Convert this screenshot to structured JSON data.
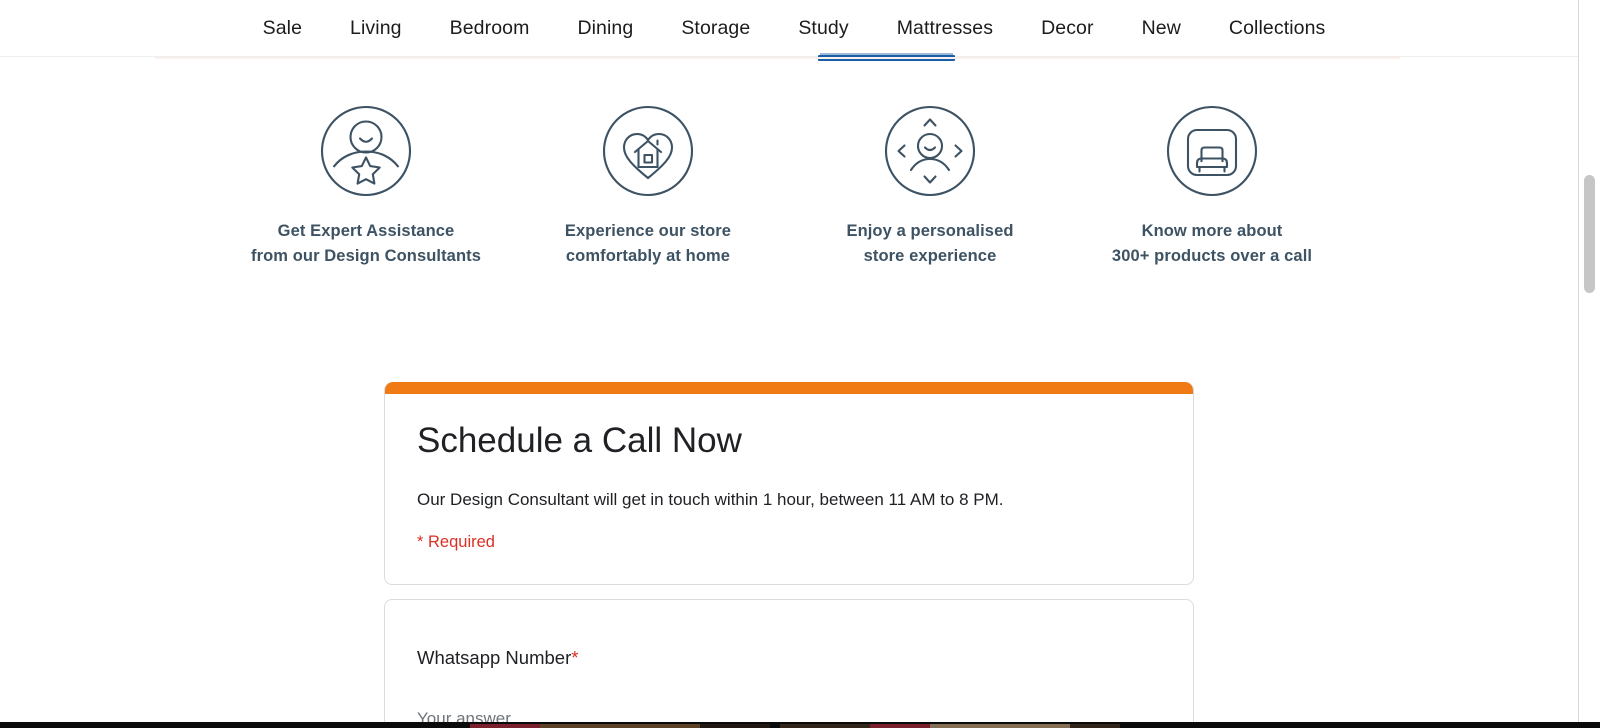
{
  "nav": {
    "items": [
      {
        "label": "Sale",
        "active": false
      },
      {
        "label": "Living",
        "active": false
      },
      {
        "label": "Bedroom",
        "active": false
      },
      {
        "label": "Dining",
        "active": false
      },
      {
        "label": "Storage",
        "active": false
      },
      {
        "label": "Study",
        "active": false
      },
      {
        "label": "Mattresses",
        "active": true
      },
      {
        "label": "Decor",
        "active": false
      },
      {
        "label": "New",
        "active": false
      },
      {
        "label": "Collections",
        "active": false
      }
    ],
    "active_item": "Mattresses",
    "active_underline_color": "#1a5eab",
    "divider_color": "#fbf0ea"
  },
  "features": [
    {
      "icon": "person-star-circle-icon",
      "line1": "Get Expert Assistance",
      "line2": "from our Design Consultants"
    },
    {
      "icon": "heart-house-circle-icon",
      "line1": "Experience our store",
      "line2": "comfortably at home"
    },
    {
      "icon": "person-arrows-circle-icon",
      "line1": "Enjoy a personalised",
      "line2": "store experience"
    },
    {
      "icon": "armchair-circle-icon",
      "line1": "Know more about",
      "line2": "300+ products over a call"
    }
  ],
  "feature_text_color": "#3d5263",
  "form": {
    "accent_color": "#f07a13",
    "title": "Schedule a Call Now",
    "description": "Our Design Consultant will get in touch within 1 hour, between 11 AM to 8 PM.",
    "required_note": "* Required",
    "required_note_color": "#d93025",
    "questions": [
      {
        "label": "Whatsapp Number",
        "required_marker": "*",
        "answer_placeholder": "Your answer",
        "value": ""
      }
    ]
  }
}
